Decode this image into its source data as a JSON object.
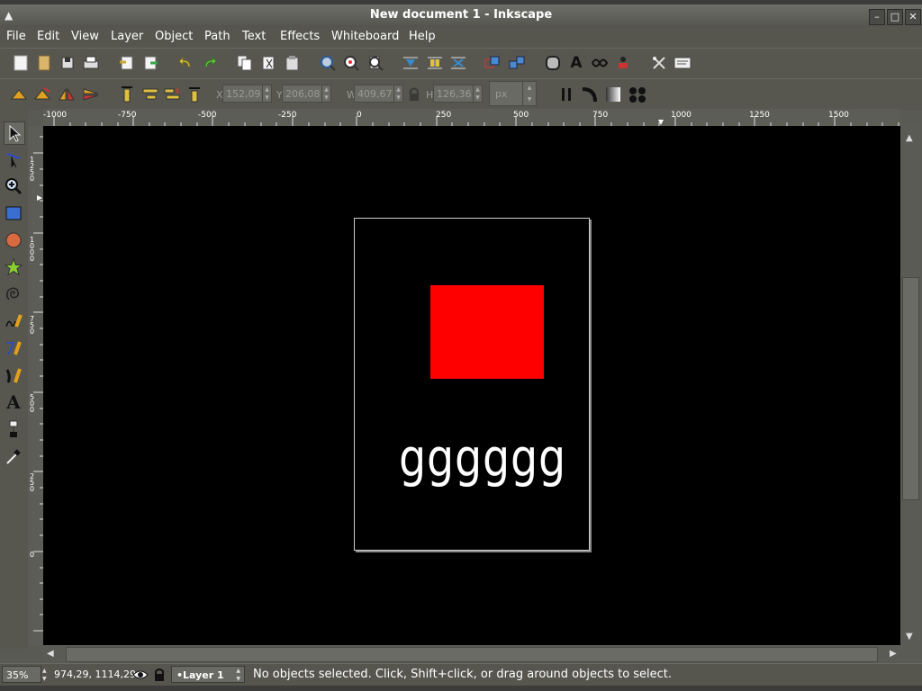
{
  "window": {
    "title": "New document 1 - Inkscape",
    "icon": "inkscape-logo-icon"
  },
  "window_buttons": {
    "minimize": "minimize-icon",
    "maximize": "maximize-icon",
    "close": "close-icon"
  },
  "menu": [
    "File",
    "Edit",
    "View",
    "Layer",
    "Object",
    "Path",
    "Text",
    "Effects",
    "Whiteboard",
    "Help"
  ],
  "controls": {
    "x_label": "X",
    "x_value": "152,09",
    "y_label": "Y",
    "y_value": "206,08",
    "w_label": "W",
    "w_value": "409,67",
    "h_label": "H",
    "h_value": "126,36",
    "unit": "px"
  },
  "hruler_labels": [
    "-1000",
    "-750",
    "-500",
    "-250",
    "0",
    "250",
    "500",
    "750",
    "1000",
    "1250",
    "1500"
  ],
  "vruler_labels": [
    "1250",
    "1000",
    "750",
    "500",
    "250",
    "0"
  ],
  "canvas": {
    "text": "gggggg",
    "rect_color": "#ff0000",
    "background": "#000000"
  },
  "status": {
    "zoom": "35%",
    "coords": "974,29, 1114,29",
    "layer": "•Layer 1",
    "message": "No objects selected. Click, Shift+click, or drag around objects to select."
  }
}
